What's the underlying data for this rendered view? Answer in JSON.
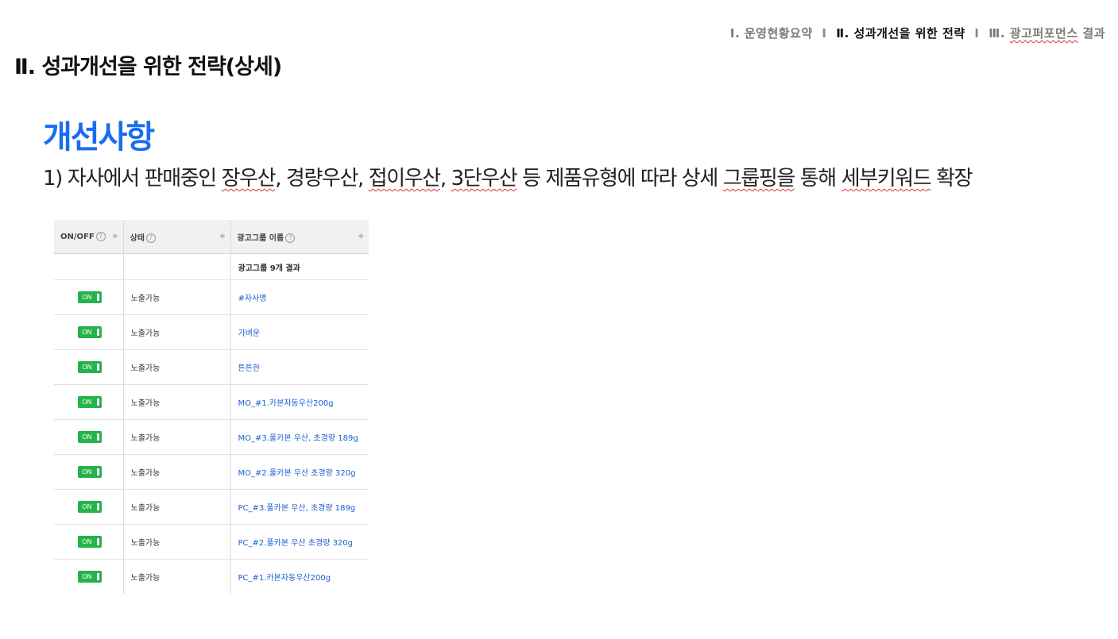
{
  "nav": {
    "item1": "Ⅰ. 운영현황요약",
    "sep1": "I",
    "item2": "Ⅱ. 성과개선을 위한 전략",
    "sep2": "I",
    "item3_prefix": "Ⅲ. ",
    "item3_word": "광고퍼포먼스",
    "item3_suffix": " 결과"
  },
  "page_title": "Ⅱ. 성과개선을 위한 전략(상세)",
  "section_heading": "개선사항",
  "description": {
    "p1": "1) 자사에서 판매중인 ",
    "w1": "장우산",
    "p2": ", 경량우산, ",
    "w2": "접이우산",
    "p3": ", ",
    "w3": "3단우산",
    "p4": " 등 제품유형에 따라 상세 ",
    "w4": "그룹핑을",
    "p5": " 통해 ",
    "w5": "세부키워드",
    "p6": " 확장"
  },
  "table": {
    "headers": [
      "ON/OFF",
      "상태",
      "광고그룹 이름"
    ],
    "help_glyph": "?",
    "sort_glyph": "≑",
    "summary": "광고그룹 9개 결과",
    "rows": [
      {
        "toggle": "ON",
        "status": "노출가능",
        "name": "#자사명"
      },
      {
        "toggle": "ON",
        "status": "노출가능",
        "name": "가벼운"
      },
      {
        "toggle": "ON",
        "status": "노출가능",
        "name": "튼튼한"
      },
      {
        "toggle": "ON",
        "status": "노출가능",
        "name": "MO_#1.카본자동우산200g"
      },
      {
        "toggle": "ON",
        "status": "노출가능",
        "name": "MO_#3.풀카본 우산, 초경량 189g"
      },
      {
        "toggle": "ON",
        "status": "노출가능",
        "name": "MO_#2.풀카본 우산 초경량 320g"
      },
      {
        "toggle": "ON",
        "status": "노출가능",
        "name": "PC_#3.풀카본 우산, 초경량 189g"
      },
      {
        "toggle": "ON",
        "status": "노출가능",
        "name": "PC_#2.풀카본 우산 초경량 320g"
      },
      {
        "toggle": "ON",
        "status": "노출가능",
        "name": "PC_#1.카본자동우산200g"
      }
    ]
  },
  "colors": {
    "accent": "#1a6df0",
    "toggle_on": "#25b34b",
    "link": "#1a5fd1"
  }
}
